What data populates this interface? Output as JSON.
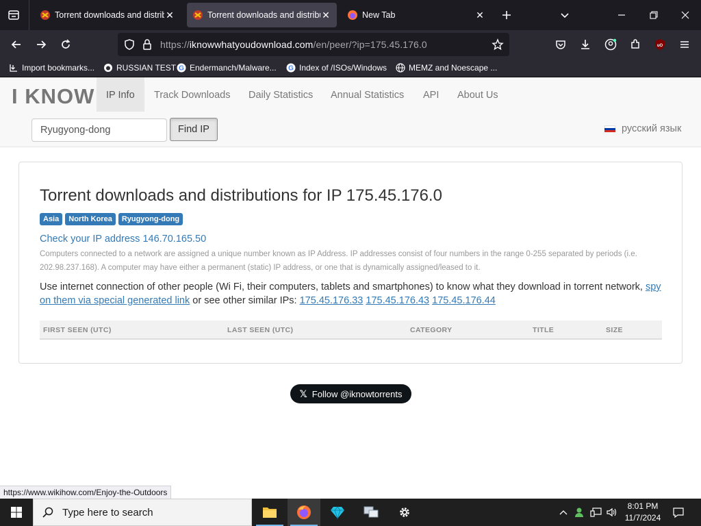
{
  "browser": {
    "tabs": [
      {
        "title": "Torrent downloads and distribu",
        "active": false
      },
      {
        "title": "Torrent downloads and distribu",
        "active": true
      },
      {
        "title": "New Tab",
        "active": false
      }
    ],
    "url_prefix": "https://",
    "url_host": "iknowwhatyoudownload.com",
    "url_path": "/en/peer/?ip=175.45.176.0",
    "bookmarks": [
      "Import bookmarks...",
      "RUSSIAN TEST",
      "Endermanch/Malware...",
      "Index of /ISOs/Windows",
      "MEMZ and Noescape ..."
    ]
  },
  "site": {
    "brand": "I KNOW",
    "nav": [
      "IP Info",
      "Track Downloads",
      "Daily Statistics",
      "Annual Statistics",
      "API",
      "About Us"
    ],
    "search_value": "Ryugyong-dong",
    "find_button": "Find IP",
    "language": "русский язык",
    "heading": "Torrent downloads and distributions for IP 175.45.176.0",
    "labels": [
      "Asia",
      "North Korea",
      "Ryugyong-dong"
    ],
    "check_ip": "Check your IP address 146.70.165.50",
    "explanation": "Computers connected to a network are assigned a unique number known as IP Address. IP addresses consist of four numbers in the range 0-255 separated by periods (i.e. 202.98.237.168). A computer may have either a permanent (static) IP address, or one that is dynamically assigned/leased to it.",
    "use_text_1": "Use internet connection of other people (Wi Fi, their computers, tablets and smartphones) to know what they download in torrent network, ",
    "spy_link": "spy on them via special generated link",
    "use_text_2": " or see other similar IPs: ",
    "similar_ips": [
      "175.45.176.33",
      "175.45.176.43",
      "175.45.176.44"
    ],
    "table_headers": [
      "FIRST SEEN (UTC)",
      "LAST SEEN (UTC)",
      "CATEGORY",
      "TITLE",
      "SIZE"
    ],
    "follow": "Follow @iknowtorrents",
    "follow_logo": "𝕏"
  },
  "status_url": "https://www.wikihow.com/Enjoy-the-Outdoors",
  "taskbar": {
    "search_placeholder": "Type here to search",
    "time": "8:01 PM",
    "date": "11/7/2024"
  },
  "colors": {
    "link": "#337ab7",
    "label_bg": "#337ab7",
    "chrome_dark": "#1c1b22",
    "chrome": "#2b2a33"
  }
}
